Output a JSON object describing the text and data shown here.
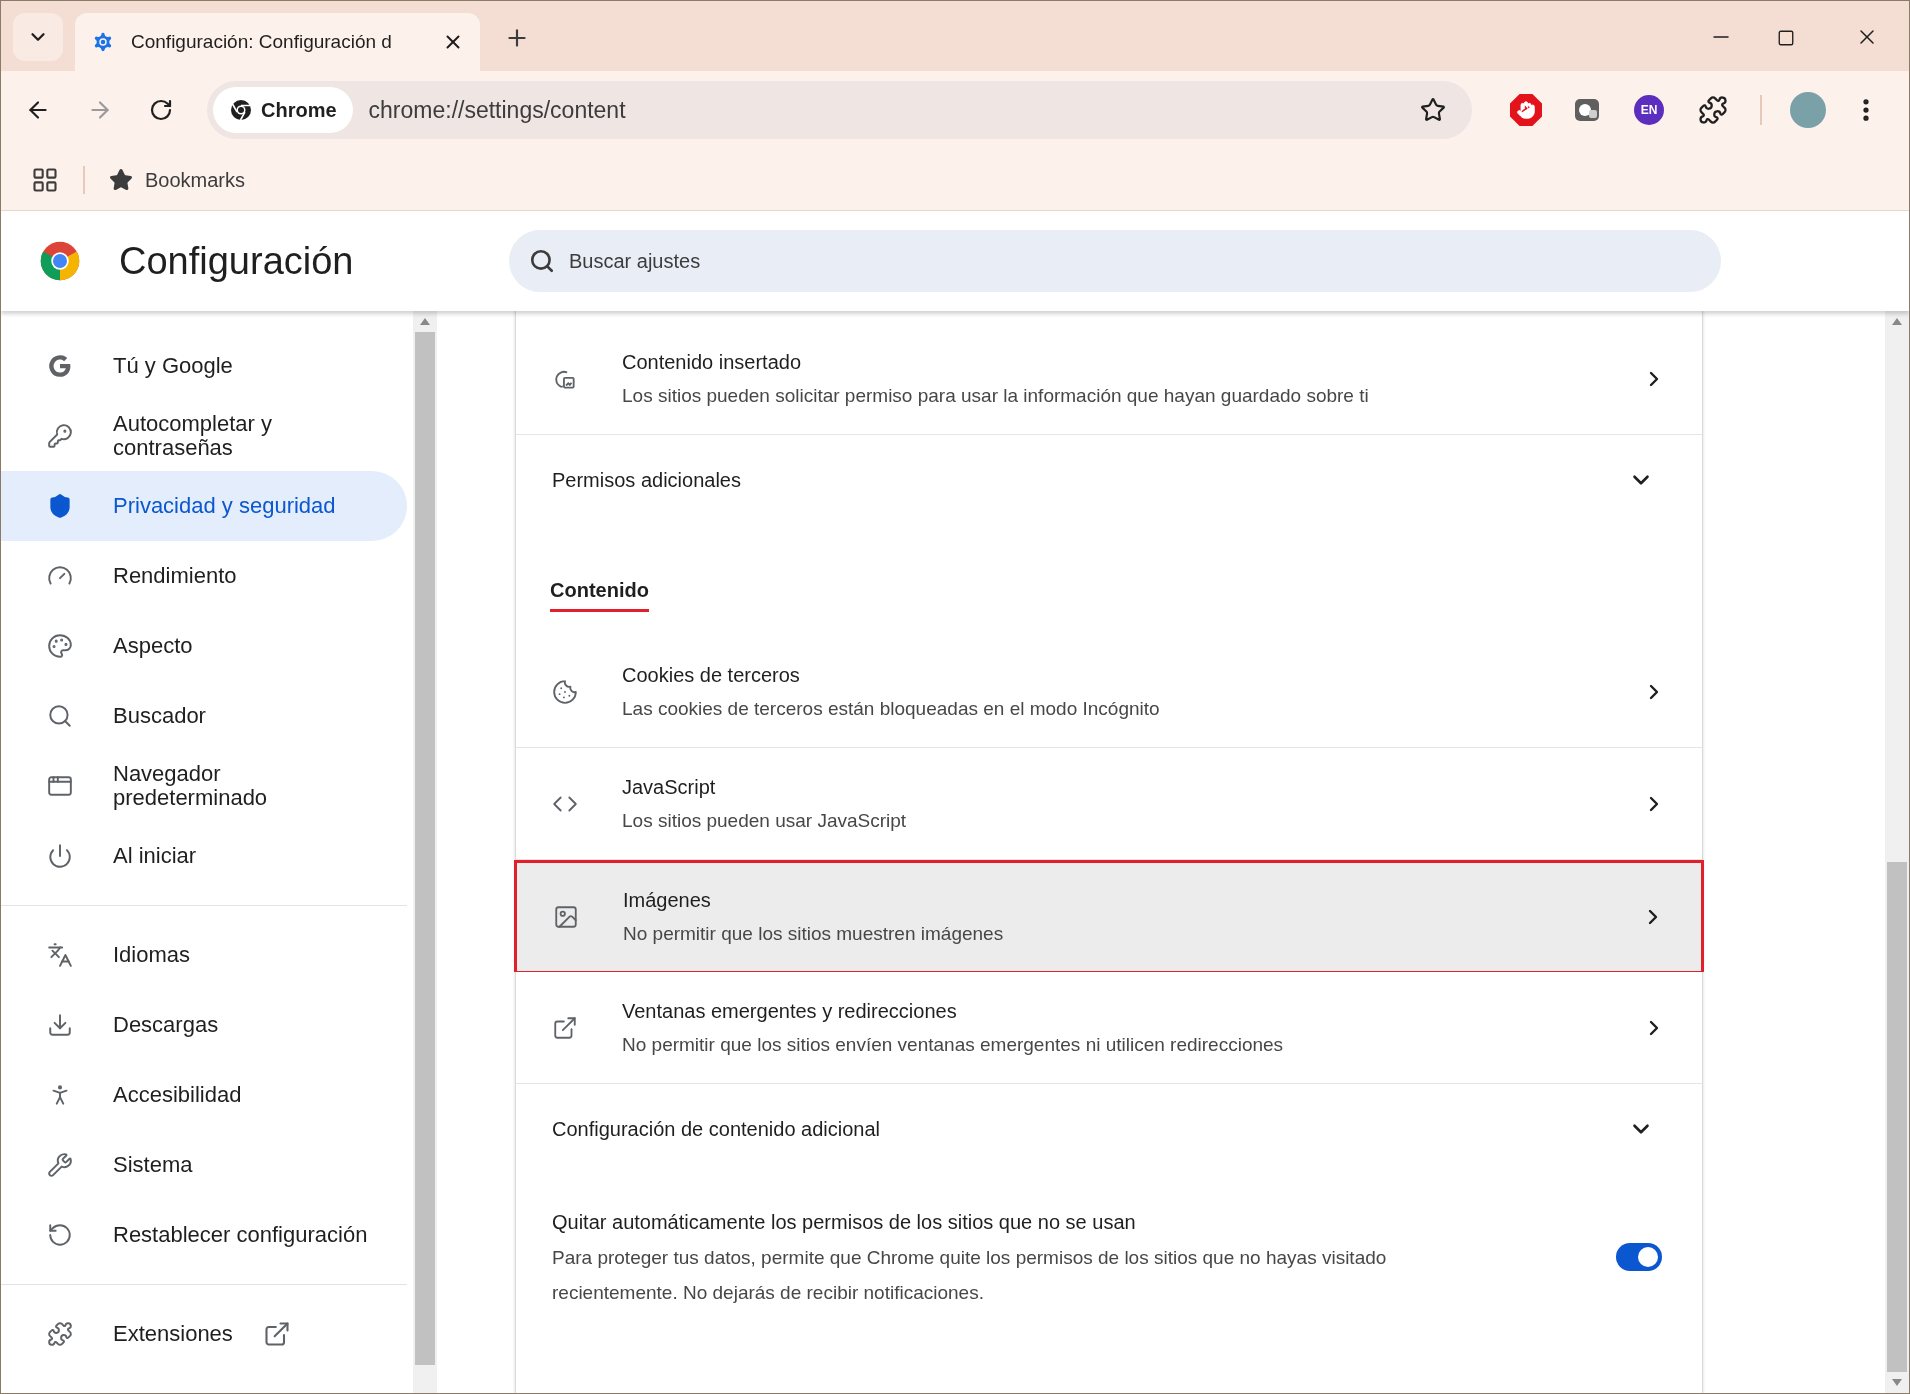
{
  "browser": {
    "tab": {
      "title": "Configuración: Configuración d",
      "selected": true
    },
    "address": {
      "chip": "Chrome",
      "url": "chrome://settings/content"
    },
    "extension_badge": "EN",
    "bookmarks": {
      "label": "Bookmarks"
    }
  },
  "header": {
    "title": "Configuración",
    "search": {
      "placeholder": "Buscar ajustes"
    }
  },
  "sidebar": {
    "groups": [
      {
        "items": [
          {
            "label": "Tú y Google",
            "selected": false
          },
          {
            "label": "Autocompletar y contraseñas",
            "selected": false
          },
          {
            "label": "Privacidad y seguridad",
            "selected": true
          },
          {
            "label": "Rendimiento",
            "selected": false
          },
          {
            "label": "Aspecto",
            "selected": false
          },
          {
            "label": "Buscador",
            "selected": false
          },
          {
            "label": "Navegador predeterminado",
            "selected": false
          },
          {
            "label": "Al iniciar",
            "selected": false
          }
        ]
      },
      {
        "items": [
          {
            "label": "Idiomas",
            "selected": false
          },
          {
            "label": "Descargas",
            "selected": false
          },
          {
            "label": "Accesibilidad",
            "selected": false
          },
          {
            "label": "Sistema",
            "selected": false
          },
          {
            "label": "Restablecer configuración",
            "selected": false
          }
        ]
      },
      {
        "items": [
          {
            "label": "Extensiones",
            "selected": false
          }
        ]
      }
    ]
  },
  "content": [
    {
      "kind": "row",
      "title": "Contenido insertado",
      "subtitle": "Los sitios pueden solicitar permiso para usar la información que hayan guardado sobre ti",
      "highlighted": false
    },
    {
      "kind": "expander",
      "label": "Permisos adicionales",
      "expanded": false
    },
    {
      "kind": "heading",
      "label": "Contenido",
      "underlined": true
    },
    {
      "kind": "row",
      "title": "Cookies de terceros",
      "subtitle": "Las cookies de terceros están bloqueadas en el modo Incógnito",
      "highlighted": false
    },
    {
      "kind": "row",
      "title": "JavaScript",
      "subtitle": "Los sitios pueden usar JavaScript",
      "highlighted": false
    },
    {
      "kind": "row",
      "title": "Imágenes",
      "subtitle": "No permitir que los sitios muestren imágenes",
      "highlighted": true
    },
    {
      "kind": "row",
      "title": "Ventanas emergentes y redirecciones",
      "subtitle": "No permitir que los sitios envíen ventanas emergentes ni utilicen redirecciones",
      "highlighted": false
    },
    {
      "kind": "expander",
      "label": "Configuración de contenido adicional",
      "expanded": false
    },
    {
      "kind": "toggle",
      "title": "Quitar automáticamente los permisos de los sitios que no se usan",
      "subtitle": "Para proteger tus datos, permite que Chrome quite los permisos de los sitios que no hayas visitado recientemente. No dejarás de recibir notificaciones.",
      "on": true
    }
  ]
}
